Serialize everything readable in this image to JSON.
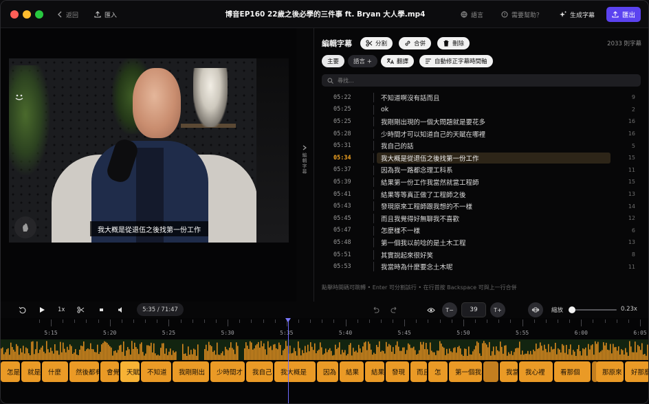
{
  "titlebar": {
    "back_label": "返回",
    "import_label": "匯入",
    "file_title": "博音EP160 22歲之後必學的三件事 ft. Bryan 大人學.mp4",
    "language_label": "語言",
    "help_label": "需要幫助？",
    "generate_label": "生成字幕",
    "export_label": "匯出"
  },
  "video": {
    "subtitle": "我大概是從退伍之後找第一份工作",
    "collapse_label": "編輯字幕"
  },
  "editor": {
    "title": "編輯字幕",
    "split_label": "分割",
    "merge_label": "合併",
    "delete_label": "刪除",
    "char_count": "2033 則字幕",
    "primary_label": "主要",
    "language_add_label": "語言 +",
    "translate_label": "翻譯",
    "autofix_label": "自動修正字幕時間軸",
    "search_placeholder": "尋找...",
    "hint": "點擊時間碼可跳轉 • Enter 可分割該行 • 在行首按 Backspace 可與上一行合併",
    "rows": [
      {
        "time": "05:22",
        "text": "不知道啊沒有話而且",
        "count": "9"
      },
      {
        "time": "05:25",
        "text": "ok",
        "count": "2"
      },
      {
        "time": "05:25",
        "text": "我剛剛出現的一個大問題就是要花多",
        "count": "16"
      },
      {
        "time": "05:28",
        "text": "少時間才可以知道自己的天賦在哪裡",
        "count": "16"
      },
      {
        "time": "05:31",
        "text": "我自己的話",
        "count": "5"
      },
      {
        "time": "05:34",
        "text": "我大概是從退伍之後找第一份工作",
        "count": "15"
      },
      {
        "time": "05:37",
        "text": "因為我一路都念理工科系",
        "count": "11"
      },
      {
        "time": "05:39",
        "text": "結果第一份工作我當然就當工程師",
        "count": "15"
      },
      {
        "time": "05:41",
        "text": "結果等等真正做了工程師之後",
        "count": "13"
      },
      {
        "time": "05:43",
        "text": "發現原來工程師跟我想的不一樣",
        "count": "14"
      },
      {
        "time": "05:45",
        "text": "而且我覺得好無聊我不喜歡",
        "count": "12"
      },
      {
        "time": "05:47",
        "text": "怎麼樣不一樣",
        "count": "6"
      },
      {
        "time": "05:48",
        "text": "第一個我以前唸的是土木工程",
        "count": "13"
      },
      {
        "time": "05:51",
        "text": "其實說起來很好笑",
        "count": "8"
      },
      {
        "time": "05:53",
        "text": "我當時為什麼要念土木呢",
        "count": "11"
      }
    ],
    "active_index": 5
  },
  "controls": {
    "speed": "1x",
    "timecode": "5:35 / 71:47",
    "font_minus": "T−",
    "font_size": "39",
    "font_plus": "T+",
    "zoom_label": "縮放",
    "zoom_value": "0.23x",
    "zoom_fraction": 0.07
  },
  "timeline": {
    "ticks": [
      "5:15",
      "5:20",
      "5:25",
      "5:30",
      "5:35",
      "5:40",
      "5:45",
      "5:50",
      "5:55",
      "6:00",
      "6:05"
    ],
    "clips": [
      {
        "label": "怎是",
        "state": "normal"
      },
      {
        "label": "就是",
        "state": "normal"
      },
      {
        "label": "什麼",
        "state": "normal"
      },
      {
        "label": "然後都有",
        "state": "normal"
      },
      {
        "label": "會覺",
        "state": "normal"
      },
      {
        "label": "天賦",
        "state": "active"
      },
      {
        "label": "不知道",
        "state": "normal"
      },
      {
        "label": "我剛剛出",
        "state": "normal"
      },
      {
        "label": "少時間才",
        "state": "normal"
      },
      {
        "label": "我自己",
        "state": "normal"
      },
      {
        "label": "我大概是",
        "state": "normal"
      },
      {
        "label": "因為",
        "state": "normal"
      },
      {
        "label": "結果",
        "state": "normal"
      },
      {
        "label": "結果",
        "state": "normal"
      },
      {
        "label": "發現",
        "state": "normal"
      },
      {
        "label": "而且",
        "state": "normal"
      },
      {
        "label": "怎",
        "state": "normal"
      },
      {
        "label": "第一個我",
        "state": "normal"
      },
      {
        "label": "",
        "state": "dim"
      },
      {
        "label": "我當",
        "state": "normal"
      },
      {
        "label": "我心裡",
        "state": "normal"
      },
      {
        "label": "看那個",
        "state": "normal"
      },
      {
        "label": "",
        "state": "dim"
      },
      {
        "label": "那原來",
        "state": "normal"
      },
      {
        "label": "好那麼",
        "state": "normal"
      }
    ]
  },
  "colors": {
    "accent": "#5b43f0",
    "active_time": "#f5a623",
    "clip": "#ea9a26",
    "waveform": "#d98a1f",
    "playhead": "#6f6cff"
  }
}
